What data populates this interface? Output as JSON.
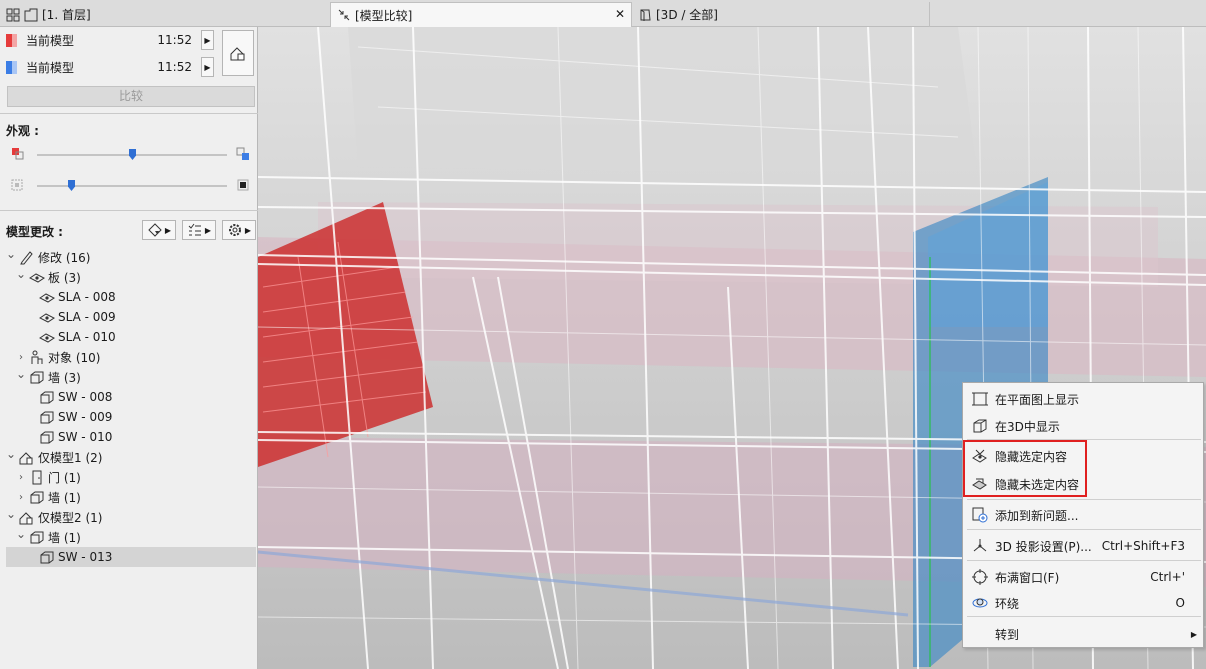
{
  "tabs": {
    "tab1": "[1. 首层]",
    "tab2": "[模型比较]",
    "tab3": "[3D / 全部]"
  },
  "compare": {
    "current_label": "当前模型",
    "current_time": "11:52",
    "current_color": "#e53b3b",
    "compare_label": "当前模型",
    "compare_time": "11:52",
    "compare_color": "#3b7de5",
    "button": "比较"
  },
  "appearance": {
    "title": "外观 :",
    "slider1": 0.5,
    "slider2": 0.18
  },
  "changes": {
    "title": "模型更改 :"
  },
  "tree": [
    {
      "label": "修改 (16)",
      "icon": "pencil-icon",
      "level": 0,
      "chev": "v"
    },
    {
      "label": "板 (3)",
      "icon": "slab-icon",
      "level": 1,
      "chev": "v"
    },
    {
      "label": "SLA - 008",
      "icon": "slab-icon",
      "level": 2,
      "chev": ""
    },
    {
      "label": "SLA - 009",
      "icon": "slab-icon",
      "level": 2,
      "chev": ""
    },
    {
      "label": "SLA - 010",
      "icon": "slab-icon",
      "level": 2,
      "chev": ""
    },
    {
      "label": "对象 (10)",
      "icon": "object-icon",
      "level": 1,
      "chev": ">"
    },
    {
      "label": "墙 (3)",
      "icon": "wall-icon",
      "level": 1,
      "chev": "v"
    },
    {
      "label": "SW - 008",
      "icon": "wall-icon",
      "level": 2,
      "chev": ""
    },
    {
      "label": "SW - 009",
      "icon": "wall-icon",
      "level": 2,
      "chev": ""
    },
    {
      "label": "SW - 010",
      "icon": "wall-icon",
      "level": 2,
      "chev": ""
    },
    {
      "label": "仅模型1 (2)",
      "icon": "model-icon",
      "level": 0,
      "chev": "v"
    },
    {
      "label": "门 (1)",
      "icon": "door-icon",
      "level": 1,
      "chev": ">"
    },
    {
      "label": "墙 (1)",
      "icon": "wall-icon",
      "level": 1,
      "chev": ">"
    },
    {
      "label": "仅模型2 (1)",
      "icon": "model-icon",
      "level": 0,
      "chev": "v"
    },
    {
      "label": "墙 (1)",
      "icon": "wall-icon",
      "level": 1,
      "chev": "v"
    },
    {
      "label": "SW - 013",
      "icon": "wall-icon",
      "level": 2,
      "chev": "",
      "selected": true
    }
  ],
  "menu": [
    {
      "label": "在平面图上显示",
      "shortcut": "",
      "icon": "floorplan-icon"
    },
    {
      "label": "在3D中显示",
      "shortcut": "",
      "icon": "3d-box-icon"
    },
    {
      "label": "隐藏选定内容",
      "shortcut": "",
      "icon": "hide-selected-icon"
    },
    {
      "label": "隐藏未选定内容",
      "shortcut": "",
      "icon": "hide-unselected-icon"
    },
    {
      "label": "添加到新问题...",
      "shortcut": "",
      "icon": "add-issue-icon"
    },
    {
      "label": "3D 投影设置(P)...",
      "shortcut": "Ctrl+Shift+F3",
      "icon": "projection-icon"
    },
    {
      "label": "布满窗口(F)",
      "shortcut": "Ctrl+'",
      "icon": "fit-window-icon"
    },
    {
      "label": "环绕",
      "shortcut": "O",
      "icon": "orbit-icon"
    },
    {
      "label": "转到",
      "shortcut": "",
      "icon": ""
    }
  ]
}
